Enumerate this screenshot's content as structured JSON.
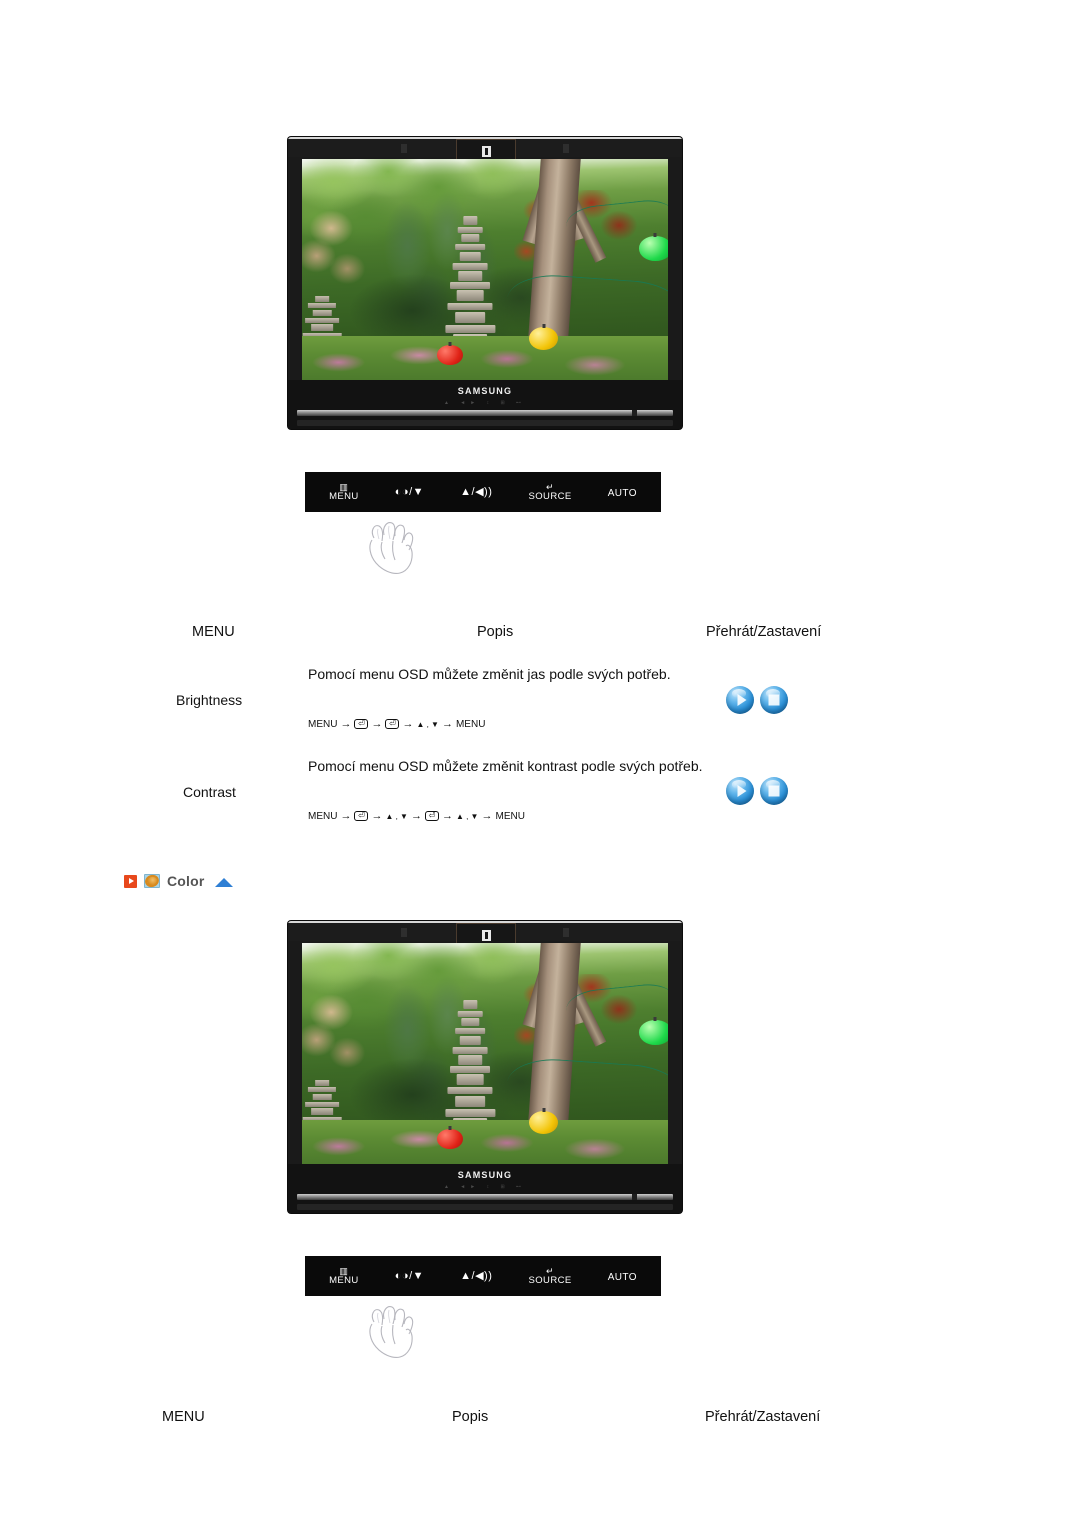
{
  "page": {
    "language": "cs",
    "background": "#ffffff"
  },
  "monitors": [
    {
      "id": "monitor-brightness-contrast",
      "brand": "SAMSUNG",
      "chin_icons": "▲  ◄► ↕  ⊞  ⊷",
      "screen_alt": "Zahradní scéna s kamennou pagodou, stromy a lampiony"
    },
    {
      "id": "monitor-color",
      "brand": "SAMSUNG",
      "chin_icons": "▲  ◄► ↕  ⊞  ⊷",
      "screen_alt": "Zahradní scéna s kamennou pagodou, stromy a lampiony"
    }
  ],
  "button_bar": {
    "buttons": [
      {
        "glyph": "▥",
        "label": "MENU",
        "name": "menu-button"
      },
      {
        "glyph": "◐◑/▼",
        "label": "",
        "name": "brightness-down-button"
      },
      {
        "glyph": "▲/◀))",
        "label": "",
        "name": "volume-up-button"
      },
      {
        "glyph": "↵",
        "label": "SOURCE",
        "name": "source-button"
      },
      {
        "glyph": "",
        "label": "AUTO",
        "name": "auto-button"
      }
    ]
  },
  "table_top": {
    "headers": {
      "menu": "MENU",
      "description": "Popis",
      "playstop": "Přehrát/Zastavení"
    },
    "rows": [
      {
        "label": "Brightness",
        "description": "Pomocí menu OSD můžete změnit jas podle svých potřeb.",
        "sequence": {
          "parts": [
            "MENU",
            "→",
            "⏎",
            "→",
            "⏎",
            "→",
            "▲ , ▼",
            "→",
            "MENU"
          ]
        },
        "play_label": "Přehrát",
        "stop_label": "Zastavení"
      },
      {
        "label": "Contrast",
        "description": "Pomocí menu OSD můžete změnit kontrast podle svých potřeb.",
        "sequence": {
          "parts": [
            "MENU",
            "→",
            "⏎",
            "→",
            "▲ , ▼",
            "→",
            "⏎",
            "→",
            "▲ , ▼",
            "→",
            "MENU"
          ]
        },
        "play_label": "Přehrát",
        "stop_label": "Zastavení"
      }
    ]
  },
  "color_section": {
    "title": "Color",
    "accent_color": "#555555",
    "play_icon_color": "#e8481c",
    "palette_icon_color": "#d88a1e",
    "top_arrow_color": "#2e7fd4"
  },
  "table_bottom": {
    "headers": {
      "menu": "MENU",
      "description": "Popis",
      "playstop": "Přehrát/Zastavení"
    }
  }
}
